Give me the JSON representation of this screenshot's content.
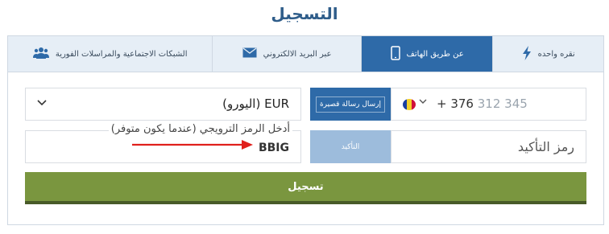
{
  "page": {
    "title": "التسجيل"
  },
  "tabs": [
    {
      "label": "نقره واحده",
      "icon": "lightning-icon",
      "active": false
    },
    {
      "label": "عن طريق الهاتف",
      "icon": "phone-icon",
      "active": true
    },
    {
      "label": "عبر البريد الالكتروني",
      "icon": "envelope-icon",
      "active": false
    },
    {
      "label": "الشبكات الاجتماعية والمراسلات الفورية",
      "icon": "users-icon",
      "active": false
    }
  ],
  "form": {
    "currency": {
      "value": "EUR (اليورو)"
    },
    "phone": {
      "country_code": "+ 376",
      "placeholder": "312 345",
      "flag": "andorra-flag"
    },
    "send_sms_label": "إرسال رسالة قصيرة",
    "promo": {
      "legend": "أدخل الرمز الترويجي (عندما يكون متوفر)",
      "value": "BBIG"
    },
    "confirm_button_label": "التأكيد",
    "confirm_code_label": "رمز التأكيد",
    "submit_label": "تسجيل"
  },
  "colors": {
    "accent": "#2e6aa8",
    "submit": "#7a963f",
    "arrow": "#e0201c"
  }
}
